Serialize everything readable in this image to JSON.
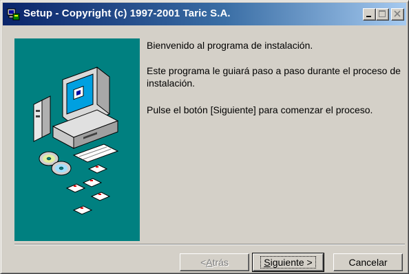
{
  "window": {
    "title": "Setup - Copyright (c) 1997-2001 Taric S.A.",
    "controls": [
      "minimize",
      "maximize",
      "close"
    ]
  },
  "content": {
    "messages": [
      "Bienvenido al programa de instalación.",
      "Este programa le guiará paso a paso durante el proceso de instalación.",
      "Pulse el botón [Siguiente] para comenzar el proceso."
    ]
  },
  "buttons": {
    "back": {
      "prefix": "< ",
      "accel": "A",
      "rest": "trás",
      "enabled": false
    },
    "next": {
      "accel": "S",
      "rest": "iguiente >",
      "enabled": true
    },
    "cancel": {
      "label": "Cancelar",
      "enabled": true
    }
  },
  "icons": {
    "app": "setup-icon",
    "illustration": "computer-with-discs-illustration"
  },
  "colors": {
    "title_start": "#0a246a",
    "title_end": "#a6caf0",
    "panel": "#008080",
    "face": "#d4d0c8"
  }
}
